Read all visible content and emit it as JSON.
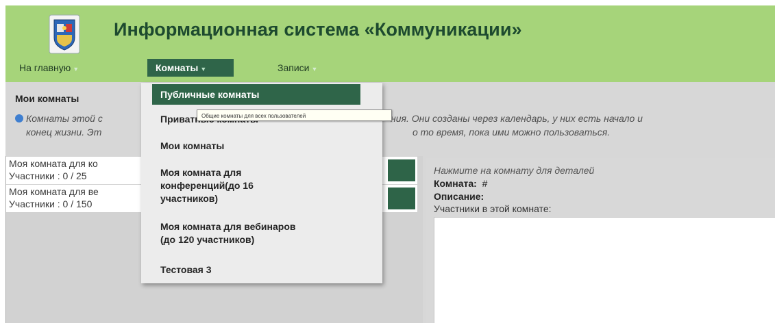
{
  "header": {
    "title": "Информационная система «Коммуникации»",
    "logo_icon": "emblem-logo-icon"
  },
  "menu": {
    "home": "На главную",
    "rooms": "Комнаты",
    "records": "Записи",
    "caret": "▼"
  },
  "section": {
    "title": "Мои комнаты",
    "info_line1": "Комнаты этой с",
    "info_line1_end": "ния. Они созданы через календарь, у них есть начало и",
    "info_line2": "конец жизни. Эт",
    "info_line2_end": "о то время, пока ими можно пользоваться."
  },
  "room_list": [
    {
      "name": "Моя комната для ко",
      "participants": "Участники : 0 / 25"
    },
    {
      "name": "Моя комната для ве",
      "participants": "Участники : 0 / 150"
    }
  ],
  "details": {
    "hint": "Нажмите на комнату для деталей",
    "room_label": "Комната:",
    "room_value": "#",
    "description_label": "Описание:",
    "participants_label": "Участники в этой комнате:"
  },
  "dropdown": {
    "items": [
      "Публичные комнаты",
      "Приватные комнаты",
      "Мои комнаты",
      "Моя комната для",
      "конференций(до 16",
      "участников)",
      "Моя комната для вебинаров",
      "(до 120 участников)",
      "Тестовая 3"
    ],
    "tooltip": "Общие комнаты для всех пользователей"
  },
  "colors": {
    "header": "#a6d47a",
    "accent": "#2f6549",
    "title": "#1d4a2f"
  }
}
